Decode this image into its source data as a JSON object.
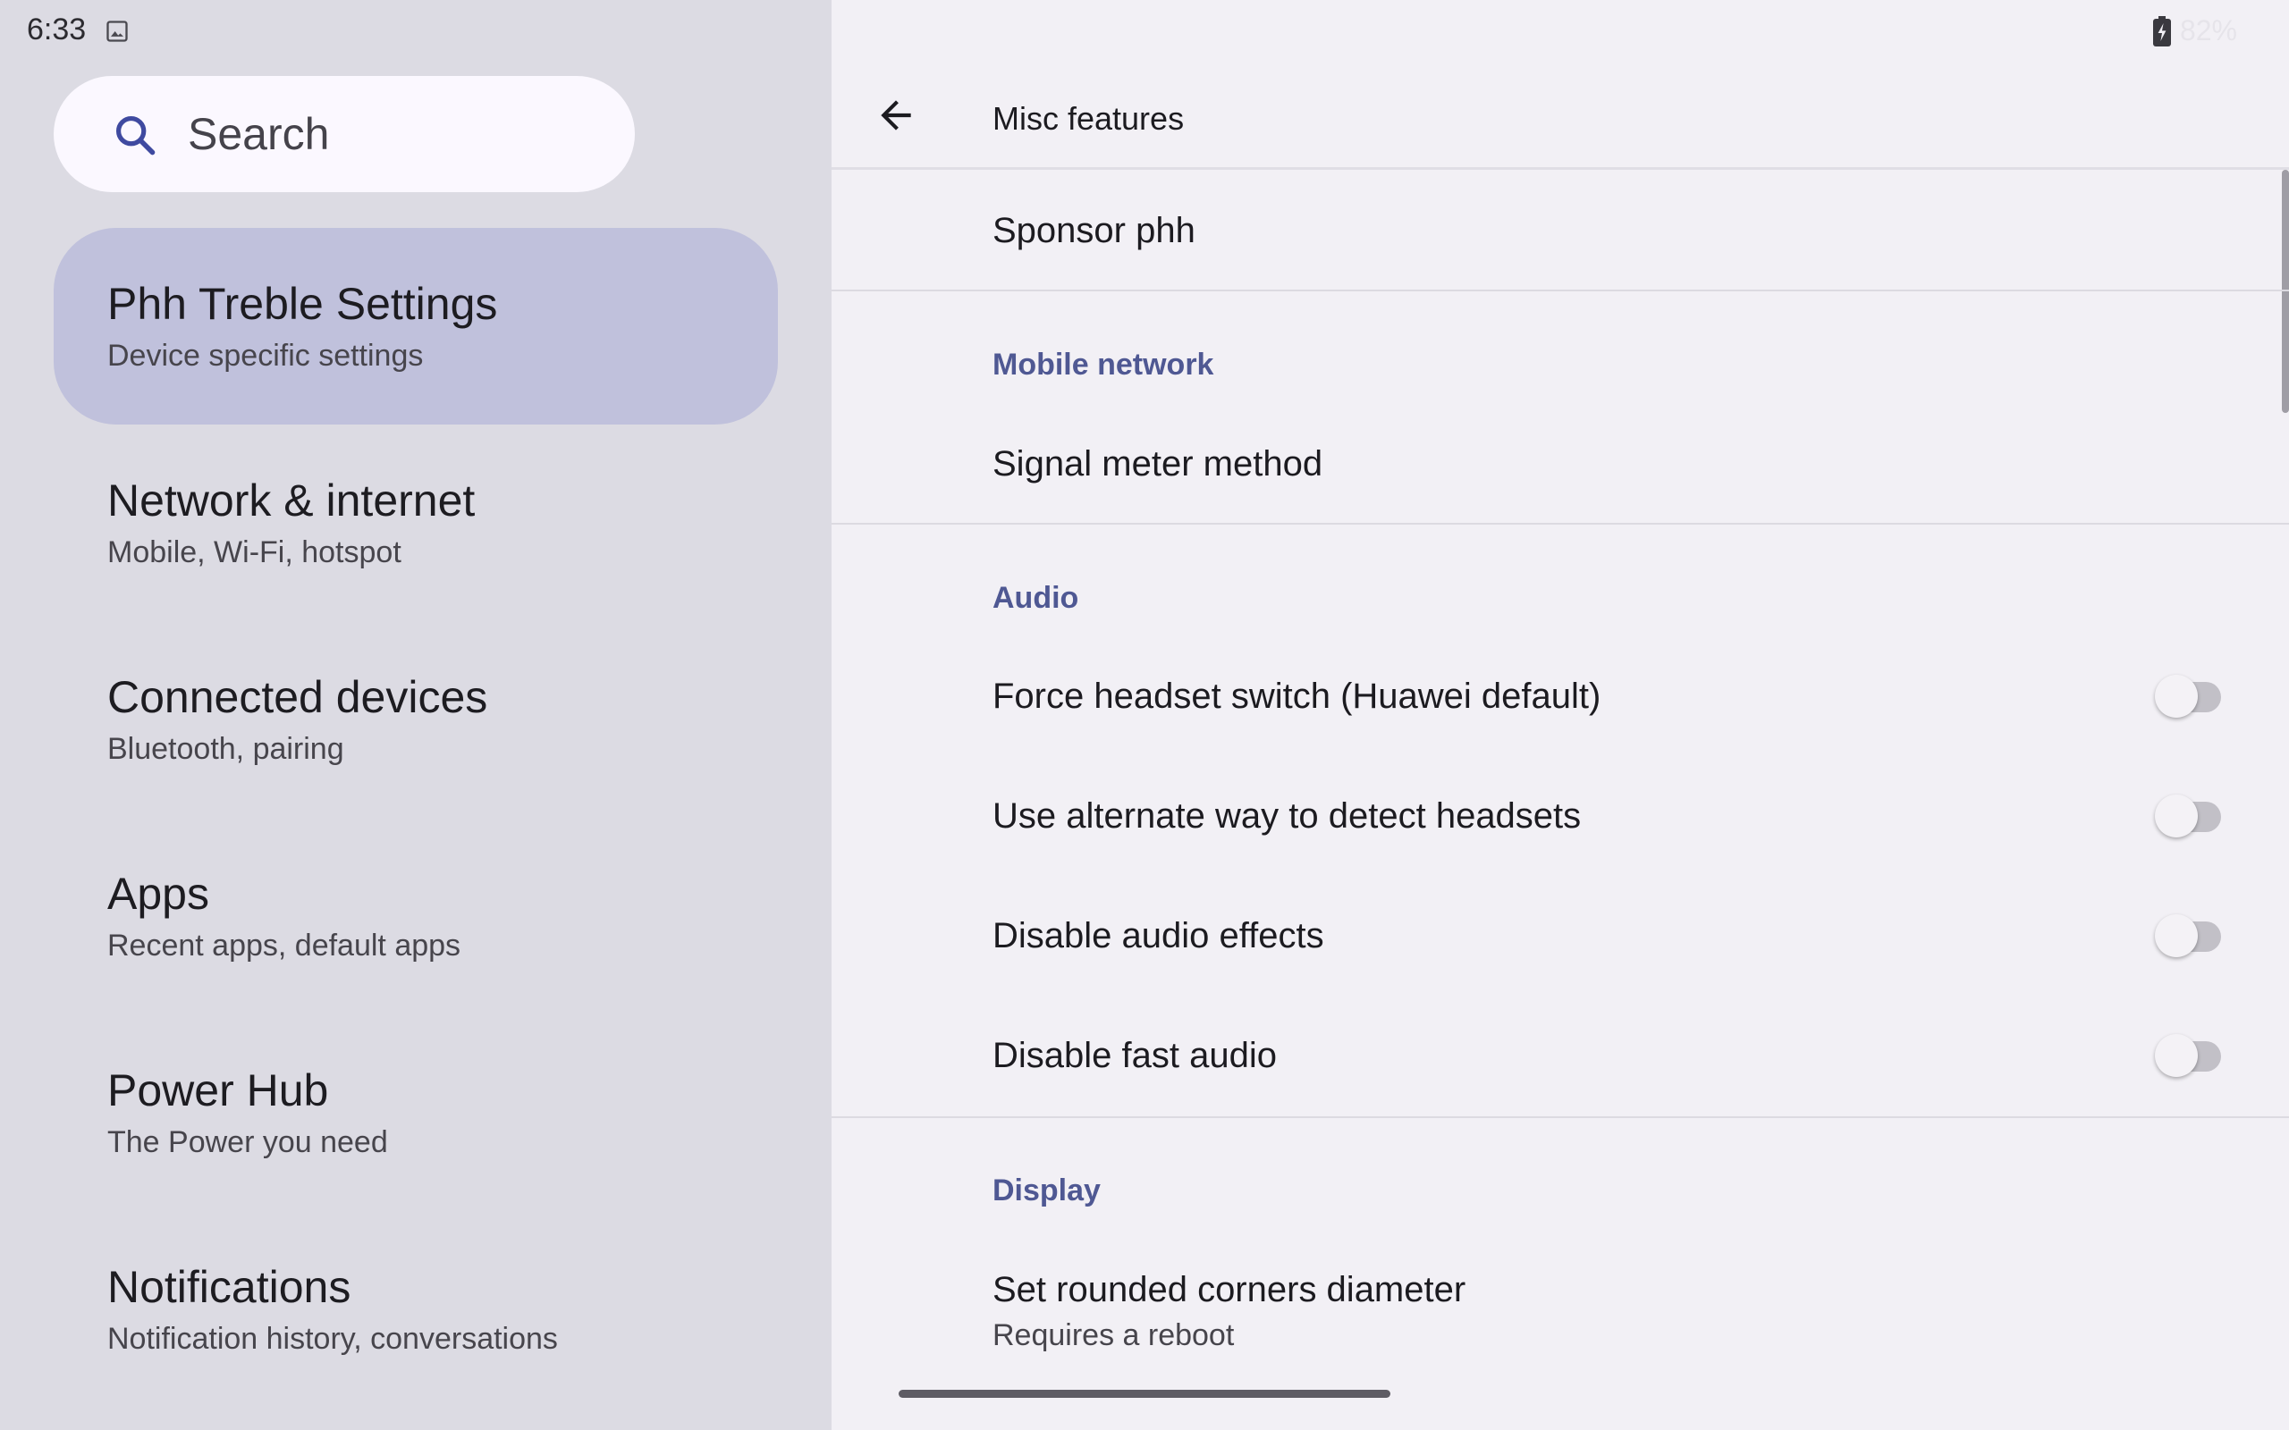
{
  "status_bar": {
    "time": "6:33",
    "battery_text": "82%"
  },
  "search": {
    "placeholder": "Search"
  },
  "sidebar": {
    "items": [
      {
        "title": "Phh Treble Settings",
        "subtitle": "Device specific settings",
        "selected": true
      },
      {
        "title": "Network & internet",
        "subtitle": "Mobile, Wi-Fi, hotspot",
        "selected": false
      },
      {
        "title": "Connected devices",
        "subtitle": "Bluetooth, pairing",
        "selected": false
      },
      {
        "title": "Apps",
        "subtitle": "Recent apps, default apps",
        "selected": false
      },
      {
        "title": "Power Hub",
        "subtitle": "The Power you need",
        "selected": false
      },
      {
        "title": "Notifications",
        "subtitle": "Notification history, conversations",
        "selected": false
      }
    ]
  },
  "detail": {
    "title": "Misc features",
    "sponsor": "Sponsor phh",
    "mobile_network": {
      "header": "Mobile network",
      "signal_meter": "Signal meter method"
    },
    "audio": {
      "header": "Audio",
      "options": [
        {
          "label": "Force headset switch (Huawei default)",
          "enabled": false
        },
        {
          "label": "Use alternate way to detect headsets",
          "enabled": false
        },
        {
          "label": "Disable audio effects",
          "enabled": false
        },
        {
          "label": "Disable fast audio",
          "enabled": false
        }
      ]
    },
    "display": {
      "header": "Display",
      "rounded_corners": "Set rounded corners diameter",
      "rounded_corners_summary": "Requires a reboot"
    }
  },
  "colors": {
    "accent": "#4f5893",
    "selected_bg": "#c0c1dc",
    "sidebar_bg": "#dcdbe3",
    "content_bg": "#f2f0f5"
  }
}
